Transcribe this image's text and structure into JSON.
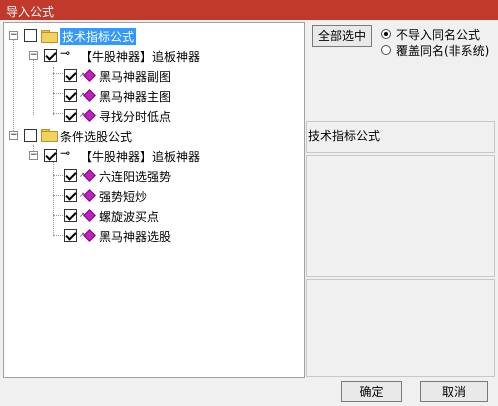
{
  "window": {
    "title": "导入公式"
  },
  "tree": {
    "nodes": [
      {
        "label": "技术指标公式",
        "checked": false
      },
      {
        "label": "【牛股神器】追板神器",
        "checked": true
      },
      {
        "label": "黑马神器副图",
        "checked": true
      },
      {
        "label": "黑马神器主图",
        "checked": true
      },
      {
        "label": "寻找分时低点",
        "checked": true
      },
      {
        "label": "条件选股公式",
        "checked": false
      },
      {
        "label": "【牛股神器】追板神器",
        "checked": true
      },
      {
        "label": "六连阳选强势",
        "checked": true
      },
      {
        "label": "强势短炒",
        "checked": true
      },
      {
        "label": "螺旋波买点",
        "checked": true
      },
      {
        "label": "黑马神器选股",
        "checked": true
      }
    ]
  },
  "options": {
    "select_all": "全部选中",
    "radio_no_import": "不导入同名公式",
    "radio_overwrite": "覆盖同名(非系统)",
    "selected": "no_import"
  },
  "info": {
    "type_label": "技术指标公式"
  },
  "footer": {
    "ok": "确定",
    "cancel": "取消"
  }
}
